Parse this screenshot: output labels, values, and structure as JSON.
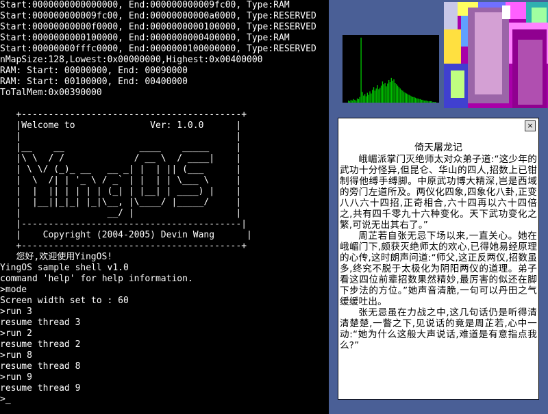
{
  "console": {
    "lines": [
      "Start:0000000000000000, End:000000000009fc00, Type:RAM",
      "Start:000000000009fc00, End:00000000000a0000, Type:RESERVED",
      "Start:00000000000f0000, End:0000000000100000, Type:RESERVED",
      "Start:0000000000100000, End:0000000000400000, Type:RAM",
      "Start:00000000fffc0000, End:0000000100000000, Type:RESERVED",
      "nMapSize:128,Lowest:0x00000000,Highest:0x00400000",
      "RAM: Start: 00000000, End: 00090000",
      "RAM: Start: 00100000, End: 00400000",
      "ToTalMem:0x00390000",
      "",
      "   +-----------------------------------------+",
      "   |Welcome to              Ver: 1.0.0      |",
      "   |                                        |",
      "   |__    __              ____    _____     |",
      "   |\\ \\  / /             / __ \\  / ____|    |",
      "   | \\ \\/ (_)_ __   __ _| |  | || (___      |",
      "   |  \\  /| | '_ \\ / _` | |  | | \\___ \\     |",
      "   |  |  || | | | | (_| | |__| | ____) |    |",
      "   |  |__||_|_| |_|\\__, |\\____/ |_____/     |",
      "   |                __/ |                   |",
      "   |-----------------------------------------|",
      "   |    Copyright (2004-2005) Devin Wang      |",
      "   +-----------------------------------------+",
      "   您好,欢迎使用YingOS!",
      "YingOS sample shell v1.0",
      "command 'help' for help information.",
      ">mode",
      "Screen width set to : 60",
      ">run 3",
      "resume thread 3",
      ">run 2",
      "resume thread 2",
      ">run 8",
      "resume thread 8",
      ">run 9",
      "resume thread 9",
      ">_"
    ]
  },
  "reader": {
    "close_icon": "×",
    "title": "倚天屠龙记",
    "paragraphs": [
      "峨嵋派掌门灭绝师太对众弟子道:“这少年的武功十分怪异,但昆仑、华山的四人,招数上已钳制得他缚手缚脚。中原武功博大精深,岂是西域的旁门左道所及。两仪化四象,四象化八卦,正变八八六十四招,正奇相合,六十四再以六十四倍之,共有四千零九十六种变化。天下武功变化之繁,可说无出其右了。”",
      "周芷若自张无忌下场以来,一直关心。她在峨嵋门下,颇获灭绝师太的欢心,已得她易经原理的心传,这时朗声问道:“师父,这正反两仪,招数虽多,终究不脱于太极化为阴阳两仪的道理。弟子看这四位前辈招数果然精妙,最厉害的似还在脚下步法的方位。”她声音清脆,一句可以丹田之气缓缓吐出。",
      "张无忌虽在力战之中,这几句话仍是听得清清楚楚,一瞥之下,见说话的竟是周芷若,心中一动:“她为什么这般大声说话,难道是有意指点我么?”"
    ]
  },
  "colors": {
    "desktop": "#4a5f96",
    "histogram": "#00c000",
    "console_text": "#ffffff"
  },
  "histogram": {
    "values": [
      3,
      2,
      4,
      3,
      5,
      4,
      3,
      6,
      5,
      8,
      92,
      15,
      10,
      12,
      9,
      14,
      11,
      16,
      13,
      18,
      22,
      17,
      20,
      25,
      19,
      21,
      24,
      30,
      26,
      28,
      23,
      27,
      32,
      29,
      35,
      31,
      33,
      28,
      26,
      24,
      22,
      20,
      18,
      17,
      15,
      14,
      13,
      12,
      11,
      10,
      9,
      8,
      8,
      7,
      6,
      6,
      5,
      5,
      4,
      4,
      3,
      3,
      3,
      2,
      2,
      2,
      2,
      1,
      1,
      1
    ]
  }
}
